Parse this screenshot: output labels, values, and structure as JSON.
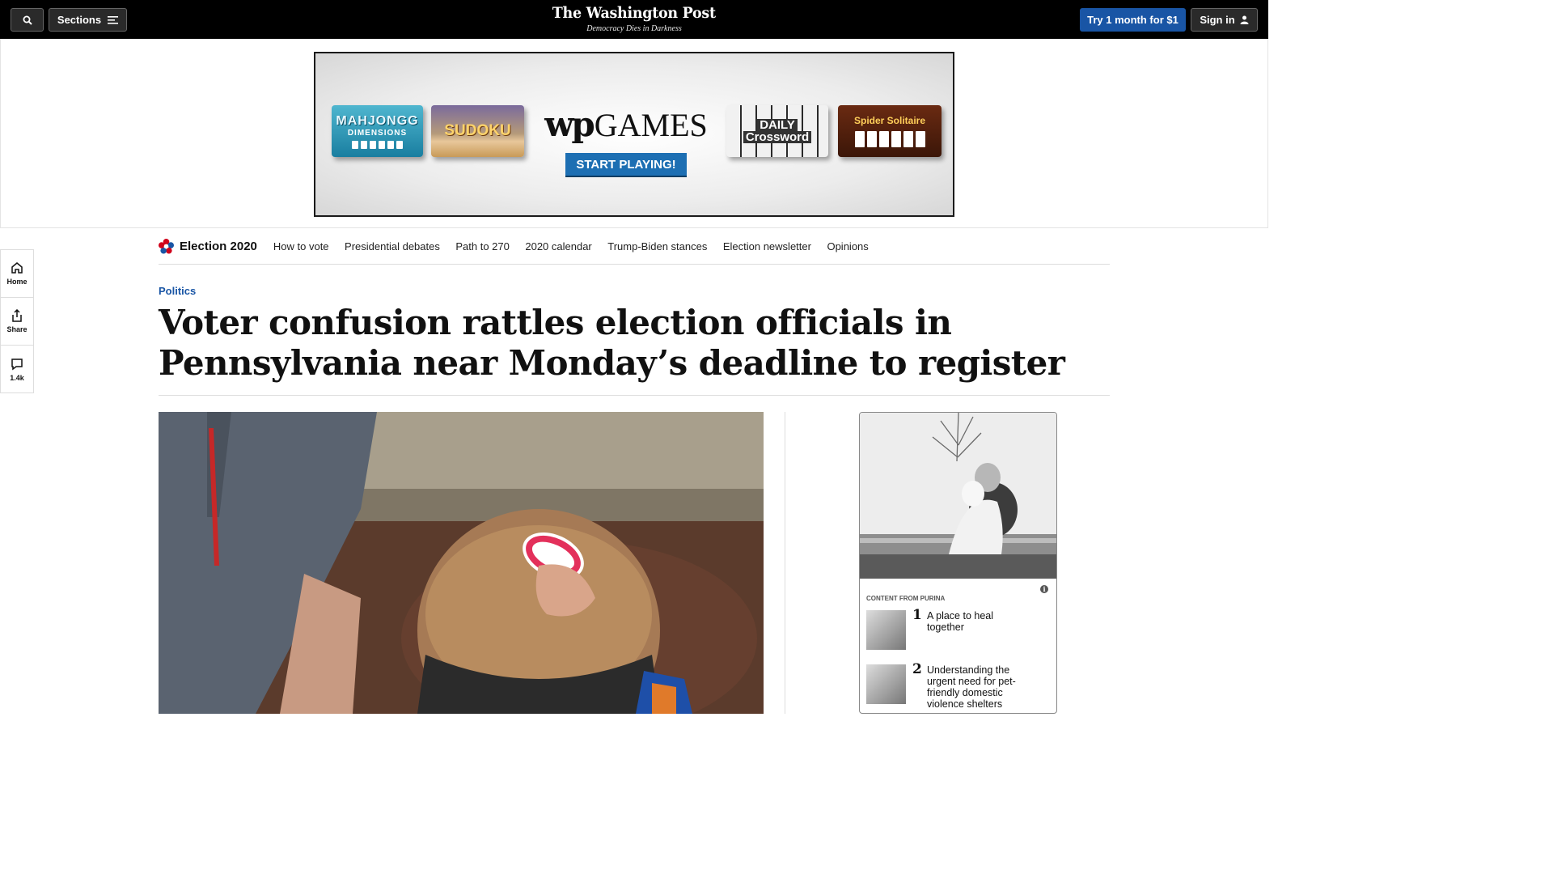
{
  "topbar": {
    "sections_label": "Sections",
    "logo": "The Washington Post",
    "tagline": "Democracy Dies in Darkness",
    "subscribe_label": "Try 1 month for $1",
    "signin_label": "Sign in"
  },
  "ad": {
    "tiles": {
      "mahjongg": [
        "MAHJONGG",
        "DIMENSIONS"
      ],
      "sudoku": "SUDOKU",
      "crossword": [
        "DAILY",
        "Crossword"
      ],
      "solitaire": "Spider Solitaire"
    },
    "brand_wp": "wp",
    "brand_games": "GAMES",
    "cta": "START PLAYING!"
  },
  "rail": {
    "home": "Home",
    "share": "Share",
    "comments": "1.4k"
  },
  "election_nav": {
    "title": "Election 2020",
    "links": [
      "How to vote",
      "Presidential debates",
      "Path to 270",
      "2020 calendar",
      "Trump-Biden stances",
      "Election newsletter",
      "Opinions"
    ]
  },
  "article": {
    "kicker": "Politics",
    "headline": "Voter confusion rattles election officials in Pennsylvania near Monday’s deadline to register"
  },
  "side_ad": {
    "source": "CONTENT FROM PURINA",
    "stories": [
      {
        "num": "1",
        "title": "A place to heal together"
      },
      {
        "num": "2",
        "title": "Understanding the urgent need for pet-friendly domestic violence shelters"
      }
    ]
  },
  "colors": {
    "accent_blue": "#1955a5",
    "topbar_bg": "#000000"
  }
}
